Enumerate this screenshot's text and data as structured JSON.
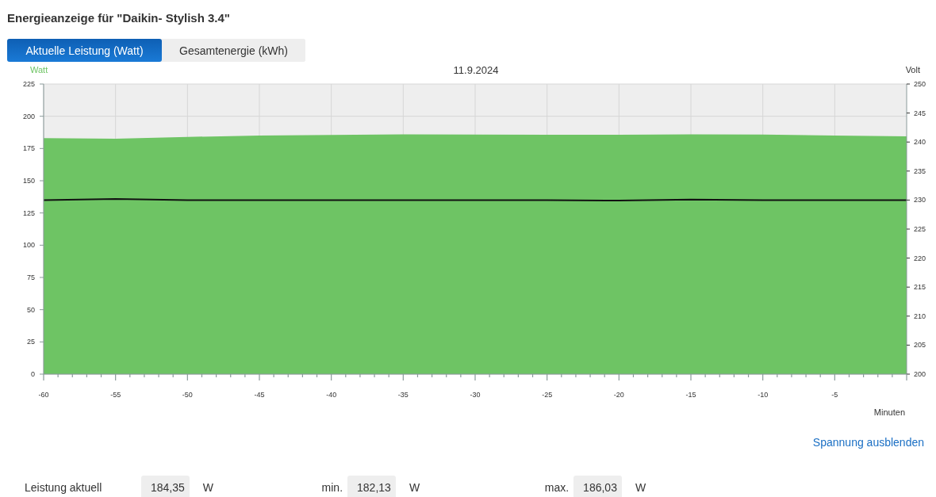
{
  "title": "Energieanzeige für \"Daikin- Stylish 3.4\"",
  "tabs": [
    {
      "label": "Aktuelle Leistung (Watt)",
      "selected": true
    },
    {
      "label": "Gesamtenergie (kWh)",
      "selected": false
    }
  ],
  "chart": {
    "chart_data": {
      "type": "area",
      "title": "11.9.2024",
      "xlabel": "Minuten",
      "x": [
        -60,
        -55,
        -50,
        -45,
        -40,
        -35,
        -30,
        -25,
        -20,
        -15,
        -10,
        -5,
        0
      ],
      "series": [
        {
          "name": "Watt",
          "color": "#6ec464",
          "values": [
            183,
            182.5,
            184,
            185,
            185.5,
            186,
            185.8,
            185.7,
            185.6,
            186,
            185.8,
            185,
            184.5
          ]
        },
        {
          "name": "Volt",
          "color": "#111111",
          "axis": "y2",
          "type": "line",
          "values": [
            230,
            230.2,
            230,
            230,
            230,
            230,
            230,
            230,
            229.9,
            230.1,
            230,
            230,
            230
          ]
        }
      ],
      "grid": true,
      "xlim": [
        -60,
        0
      ],
      "ylim": [
        0,
        225
      ],
      "y2lim": [
        200,
        250
      ],
      "xticks": [
        -60,
        -55,
        -50,
        -45,
        -40,
        -35,
        -30,
        -25,
        -20,
        -15,
        -10,
        -5
      ],
      "yticks": [
        0,
        25,
        50,
        75,
        100,
        125,
        150,
        175,
        200,
        225
      ],
      "y2ticks": [
        200,
        205,
        210,
        215,
        220,
        225,
        230,
        235,
        240,
        245,
        250
      ]
    }
  },
  "toggle_link": "Spannung ausblenden",
  "stats": [
    {
      "label": "Leistung aktuell",
      "value": "184,35",
      "unit": "W"
    },
    {
      "label": "min.",
      "value": "182,13",
      "unit": "W"
    },
    {
      "label": "max.",
      "value": "186,03",
      "unit": "W"
    }
  ]
}
